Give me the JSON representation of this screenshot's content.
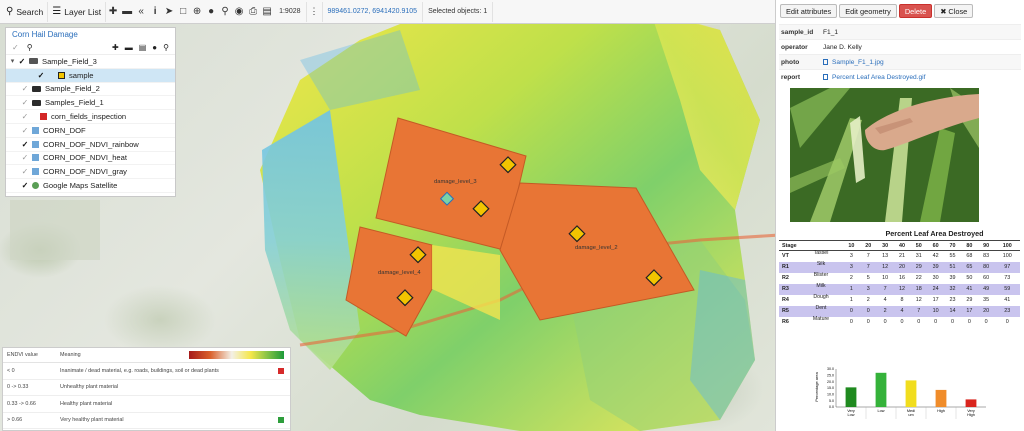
{
  "toolbar": {
    "search_label": "Search",
    "layerlist_label": "Layer List",
    "scale": "1:9028",
    "coordinates": "989461.0272, 6941420.9105",
    "selected_objects": "Selected objects: 1"
  },
  "layers_panel": {
    "title": "Corn Hail Damage",
    "items": [
      {
        "label": "Sample_Field_3",
        "checked": true,
        "type": "folder-open",
        "indent": 0
      },
      {
        "label": "sample",
        "checked": true,
        "type": "sample",
        "indent": 2,
        "selected": true
      },
      {
        "label": "Sample_Field_2",
        "checked": false,
        "type": "folder",
        "indent": 1
      },
      {
        "label": "Samples_Field_1",
        "checked": false,
        "type": "folder",
        "indent": 1
      },
      {
        "label": "corn_fields_inspection",
        "checked": false,
        "type": "vector",
        "indent": 1
      },
      {
        "label": "CORN_DOF",
        "checked": false,
        "type": "raster",
        "indent": 1
      },
      {
        "label": "CORN_DOF_NDVI_rainbow",
        "checked": true,
        "type": "raster",
        "indent": 1
      },
      {
        "label": "CORN_DOF_NDVI_heat",
        "checked": false,
        "type": "raster",
        "indent": 1
      },
      {
        "label": "CORN_DOF_NDVI_gray",
        "checked": false,
        "type": "raster",
        "indent": 1
      },
      {
        "label": "Google Maps Satellite",
        "checked": true,
        "type": "base",
        "indent": 1
      }
    ]
  },
  "map_labels": {
    "damage_1": "damage_level_3",
    "damage_2": "damage_level_2",
    "damage_3": "damage_level_4"
  },
  "legend": {
    "col_value": "ENDVI value",
    "col_meaning": "Meaning",
    "rows": [
      {
        "value": "< 0",
        "meaning": "Inanimate / dead material, e.g. roads, buildings, soil or dead plants",
        "color": "#d62a2a"
      },
      {
        "value": "0 -> 0.33",
        "meaning": "Unhealthy plant material",
        "color": ""
      },
      {
        "value": "0.33 -> 0.66",
        "meaning": "Healthy plant material",
        "color": ""
      },
      {
        "value": "> 0.66",
        "meaning": "Very healthy plant material",
        "color": "#2e9e3c"
      }
    ]
  },
  "panel": {
    "buttons": {
      "edit_attributes": "Edit attributes",
      "edit_geometry": "Edit geometry",
      "delete": "Delete",
      "close": "Close"
    },
    "attributes": [
      {
        "key": "sample_id",
        "value": "F1_1",
        "link": false
      },
      {
        "key": "operator",
        "value": "Jane D. Kelly",
        "link": false
      },
      {
        "key": "photo",
        "value": "Sample_F1_1.jpg",
        "link": true
      },
      {
        "key": "report",
        "value": "Percent Leaf Area Destroyed.gif",
        "link": true
      }
    ]
  },
  "chart_data": [
    {
      "type": "table",
      "title": "Percent Leaf Area Destroyed",
      "columns": [
        "Stage",
        "",
        "10",
        "20",
        "30",
        "40",
        "50",
        "60",
        "70",
        "80",
        "90",
        "100"
      ],
      "rows": [
        {
          "stage": "VT",
          "label": "Tassel",
          "values": [
            3,
            7,
            13,
            21,
            31,
            42,
            55,
            68,
            83,
            100
          ]
        },
        {
          "stage": "R1",
          "label": "Silk",
          "values": [
            3,
            7,
            12,
            20,
            29,
            39,
            51,
            65,
            80,
            97
          ]
        },
        {
          "stage": "R2",
          "label": "Blister",
          "values": [
            2,
            5,
            10,
            16,
            22,
            30,
            39,
            50,
            60,
            73
          ]
        },
        {
          "stage": "R3",
          "label": "Milk",
          "values": [
            1,
            3,
            7,
            12,
            18,
            24,
            32,
            41,
            49,
            59
          ]
        },
        {
          "stage": "R4",
          "label": "Dough",
          "values": [
            1,
            2,
            4,
            8,
            12,
            17,
            23,
            29,
            35,
            41
          ]
        },
        {
          "stage": "R5",
          "label": "Dent",
          "values": [
            0,
            0,
            2,
            4,
            7,
            10,
            14,
            17,
            20,
            23
          ]
        },
        {
          "stage": "R6",
          "label": "Mature",
          "values": [
            0,
            0,
            0,
            0,
            0,
            0,
            0,
            0,
            0,
            0
          ]
        }
      ]
    },
    {
      "type": "bar",
      "ylabel": "Percentage area",
      "ylim": [
        0,
        30
      ],
      "yticks": [
        "0.0",
        "5.0",
        "10.0",
        "15.0",
        "20.0",
        "25.0",
        "30.0"
      ],
      "categories": [
        "Very Low",
        "Low",
        "Medi um",
        "High",
        "Very High"
      ],
      "values": [
        15.5,
        27,
        21,
        13.5,
        6
      ],
      "colors": [
        "#1f8a1f",
        "#35b23a",
        "#f1dd1e",
        "#f08c2a",
        "#d9251e"
      ]
    }
  ]
}
